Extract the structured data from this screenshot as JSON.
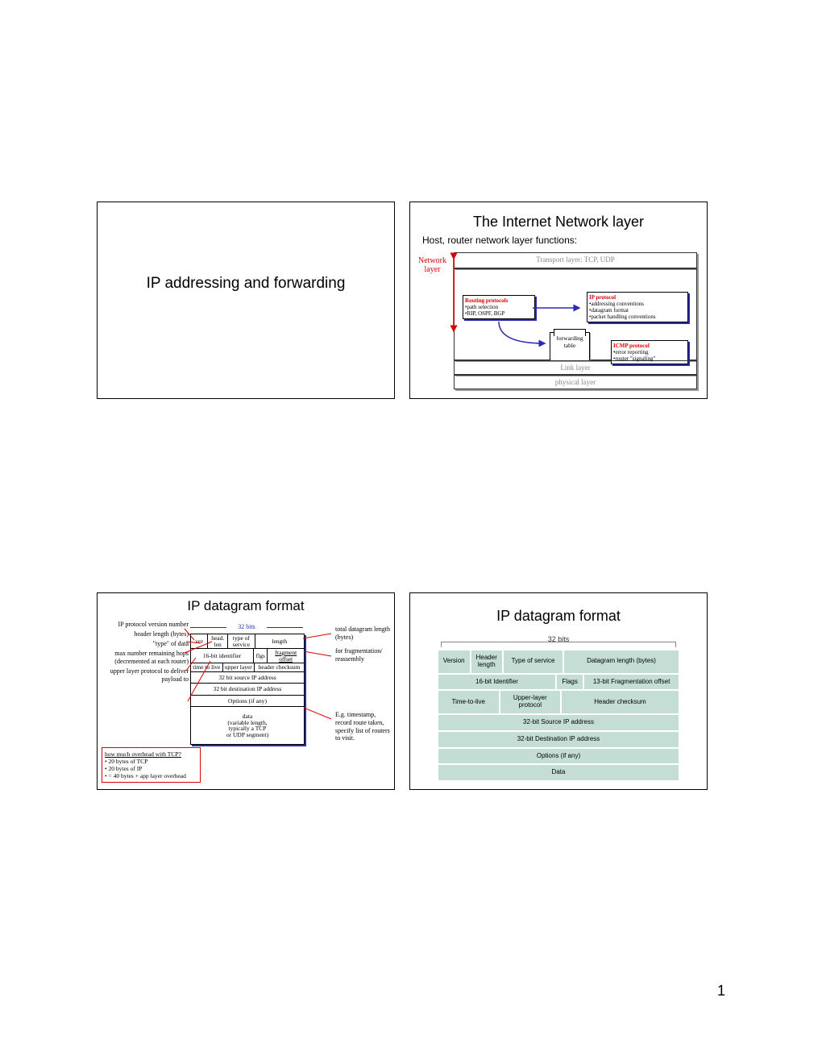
{
  "page_number": "1",
  "slide1": {
    "title": "IP addressing and forwarding"
  },
  "slide2": {
    "title": "The Internet Network layer",
    "subtitle": "Host, router network layer functions:",
    "transport": "Transport layer: TCP, UDP",
    "netlabel": "Network\nlayer",
    "routing_h": "Routing protocols",
    "routing_b1": "•path selection",
    "routing_b2": "•RIP, OSPF, BGP",
    "ip_h": "IP protocol",
    "ip_b1": "•addressing conventions",
    "ip_b2": "•datagram format",
    "ip_b3": "•packet handling conventions",
    "fwd": "forwarding\ntable",
    "icmp_h": "ICMP protocol",
    "icmp_b1": "•error reporting",
    "icmp_b2": "•router \"signaling\"",
    "link": "Link layer",
    "phys": "physical layer"
  },
  "slide3": {
    "title": "IP datagram format",
    "bits": "32 bits",
    "left_l1": "IP protocol version number",
    "left_l2": "header length (bytes)",
    "left_l3": "\"type\" of data",
    "left_l4": "max number remaining hops (decremented at each router)",
    "left_l5": "upper layer protocol to deliver payload to",
    "right_r1": "total datagram length (bytes)",
    "right_r2": "for fragmentation/ reassembly",
    "right_r3": "E.g. timestamp, record route taken, specify list of routers to visit.",
    "t_ver": "ver",
    "t_hlen": "head. len",
    "t_tos": "type of service",
    "t_len": "length",
    "t_id": "16-bit identifier",
    "t_flg": "flgs",
    "t_off": "fragment offset",
    "t_ttl": "time to live",
    "t_upper": "upper layer",
    "t_chk": "header checksum",
    "t_src": "32 bit source IP address",
    "t_dst": "32 bit destination IP address",
    "t_opt": "Options (if any)",
    "t_data": "data\n(variable length,\ntypically a TCP\nor UDP segment)",
    "ov_h": "how much overhead with TCP?",
    "ov_1": "20 bytes of TCP",
    "ov_2": "20 bytes of IP",
    "ov_3": "= 40 bytes + app layer overhead"
  },
  "slide4": {
    "title": "IP datagram format",
    "bits": "32 bits",
    "ver": "Version",
    "hlen": "Header length",
    "tos": "Type of service",
    "len": "Datagram length (bytes)",
    "id": "16-bit Identifier",
    "flg": "Flags",
    "off": "13-bit Fragmentation offset",
    "ttl": "Time-to-live",
    "upper": "Upper-layer protocol",
    "chk": "Header checksum",
    "src": "32-bit Source IP address",
    "dst": "32-bit Destination IP address",
    "opt": "Options (if any)",
    "data": "Data"
  }
}
